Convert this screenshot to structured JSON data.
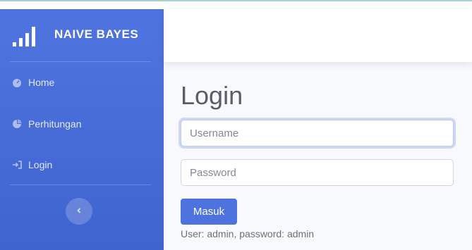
{
  "brand": {
    "title": "NAIVE BAYES",
    "icon": "signal-bars-icon"
  },
  "sidebar": {
    "items": [
      {
        "label": "Home",
        "icon": "dashboard-icon"
      },
      {
        "label": "Perhitungan",
        "icon": "pie-chart-icon"
      },
      {
        "label": "Login",
        "icon": "sign-in-icon"
      }
    ],
    "toggle_icon": "chevron-left-icon"
  },
  "login": {
    "title": "Login",
    "username_placeholder": "Username",
    "password_placeholder": "Password",
    "submit_label": "Masuk",
    "hint": "User: admin, password: admin"
  },
  "colors": {
    "primary": "#4e73df",
    "sidebar_bottom": "#3f63cf",
    "text": "#5a5c69",
    "background": "#f8f9fc"
  }
}
